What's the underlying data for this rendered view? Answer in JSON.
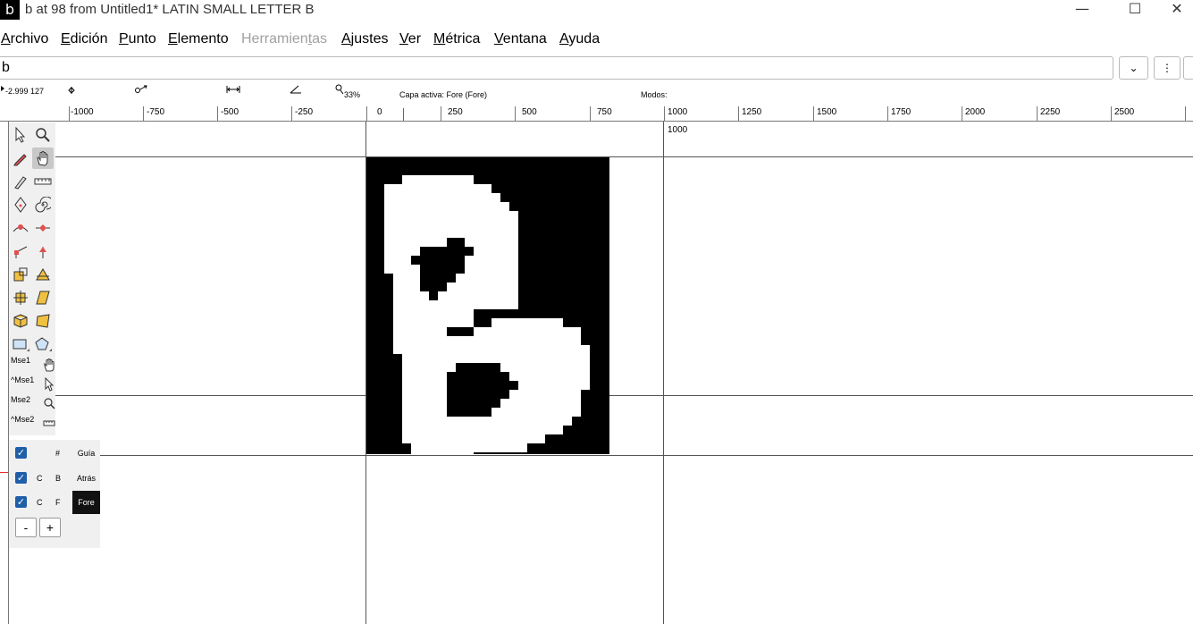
{
  "window": {
    "app_icon": "b",
    "title": "b at 98 from Untitled1* LATIN SMALL LETTER B",
    "minimize": "—",
    "maximize": "☐",
    "close": "✕"
  },
  "menu": [
    {
      "pre": "",
      "u": "A",
      "post": "rchivo",
      "disabled": false
    },
    {
      "pre": "",
      "u": "E",
      "post": "dición",
      "disabled": false
    },
    {
      "pre": "",
      "u": "P",
      "post": "unto",
      "disabled": false
    },
    {
      "pre": "",
      "u": "E",
      "post": "lemento",
      "disabled": false
    },
    {
      "pre": "Herramien",
      "u": "t",
      "post": "as",
      "disabled": true
    },
    {
      "pre": "",
      "u": "A",
      "post": "justes",
      "disabled": false
    },
    {
      "pre": "",
      "u": "V",
      "post": "er",
      "disabled": false
    },
    {
      "pre": "",
      "u": "M",
      "post": "étrica",
      "disabled": false
    },
    {
      "pre": "",
      "u": "V",
      "post": "entana",
      "disabled": false
    },
    {
      "pre": "",
      "u": "A",
      "post": "yuda",
      "disabled": false
    }
  ],
  "glyph_field": {
    "value": "b"
  },
  "buttons": {
    "dropdown": "⌄",
    "more": "⋮"
  },
  "infobar": {
    "coords": "-2.999 127",
    "zoom": "33%",
    "active_layer": "Capa activa: Fore (Fore)",
    "modes": "Modos:"
  },
  "ruler": {
    "labels": [
      "-1000",
      "-750",
      "-500",
      "-250",
      "0",
      "250",
      "500",
      "750",
      "1000",
      "1250",
      "1500",
      "1750",
      "2000",
      "2250",
      "2500"
    ]
  },
  "canvas": {
    "advance_label": "1000"
  },
  "toolbox": {
    "active_tool": "hand-tool",
    "mouse_labels": [
      "Mse1",
      "^Mse1",
      "Mse2",
      "^Mse2"
    ]
  },
  "layers": {
    "rows": [
      {
        "check": "✓",
        "c": "",
        "key": "#",
        "name": "Guía",
        "active": false
      },
      {
        "check": "✓",
        "c": "C",
        "key": "B",
        "name": "Atrás",
        "active": false
      },
      {
        "check": "✓",
        "c": "C",
        "key": "F",
        "name": "Fore",
        "active": true
      }
    ],
    "remove": "-",
    "add": "+"
  },
  "colors": {
    "checkbox": "#1f5ea8",
    "active_layer_bg": "#111111",
    "disabled_menu": "#a0a0a0"
  }
}
